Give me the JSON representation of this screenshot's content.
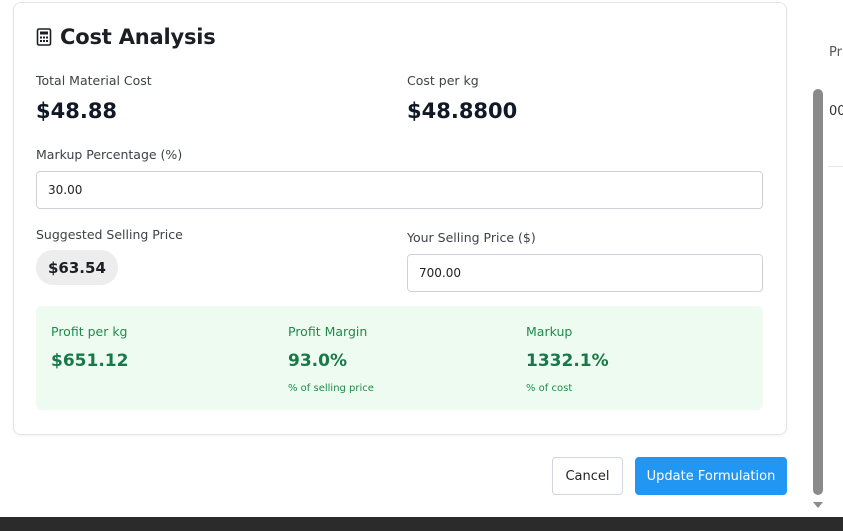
{
  "background_page": {
    "snippet_top": "Pr",
    "snippet_mid": "00"
  },
  "cost_analysis": {
    "title": "Cost Analysis",
    "icon": "calculator-icon",
    "total_material_cost_label": "Total Material Cost",
    "total_material_cost_value": "$48.88",
    "cost_per_kg_label": "Cost per kg",
    "cost_per_kg_value": "$48.8800",
    "markup_percentage_label": "Markup Percentage (%)",
    "markup_percentage_value": "30.00",
    "suggested_price_label": "Suggested Selling Price",
    "suggested_price_value": "$63.54",
    "your_price_label": "Your Selling Price ($)",
    "your_price_value": "700.00",
    "profit": {
      "per_kg_label": "Profit per kg",
      "per_kg_value": "$651.12",
      "margin_label": "Profit Margin",
      "margin_value": "93.0%",
      "margin_note": "% of selling price",
      "markup_label": "Markup",
      "markup_value": "1332.1%",
      "markup_note": "% of cost"
    }
  },
  "actions": {
    "cancel_label": "Cancel",
    "update_label": "Update Formulation"
  },
  "colors": {
    "primary": "#2196f3",
    "profit_bg": "#eefbf1",
    "profit_text": "#17794a"
  }
}
